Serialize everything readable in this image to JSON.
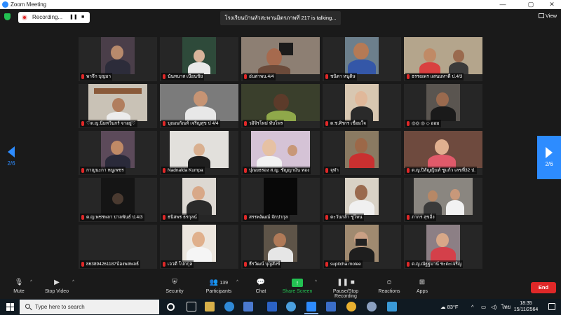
{
  "window": {
    "title": "Zoom Meeting"
  },
  "meeting_bar": {
    "recording_label": "Recording...",
    "talking_text": "โรงเรียนบ้านหัวสะพานมิตรภาพที่ 217 is talking...",
    "view_label": "View"
  },
  "paging": {
    "left_label": "2/6",
    "right_label": "2/6"
  },
  "participants": [
    "พาจึก บุญมา",
    "นันทนาส เนียนชัย",
    "อ่นสาพน.4/4",
    "ชนิดา หนูดิษ",
    "ธรรณพร แสนมหาดี ป.4/3",
    "♡ด.ญ.นิ่มหวิ่นกร์ จาอยู่♡",
    "บุณณกัณท์ เจริญสุข ป 4/4",
    "วอิจิรโหม่ ทับโพร",
    "ด.ช.ศิรกร เชื่อมใจ",
    "◎◎ ◎ ◇ ออม",
    "กาญนะกา หนูเพชร",
    "Nadnafda Kumpa",
    "ปุณยธรอง ส.ญ. ชัญญามัน ทอง",
    "จุฬา",
    "ด.ญ.ปิลัญญินท์ ชูแก้ว เลขที่32 ป.",
    "ด.ญ.พชรพลา ปาลพันธ์ ป.4/3",
    "ธนิสพร ธรกุลน์",
    "สรรพงัฒณ์ จักปากุล",
    "ตะวันกล้า ชูไหน",
    "ภากร สุขอิ่ง",
    "863894261187น้องพลพลธ์",
    "เจวดี โปกกุล",
    "ธีรวัฒน์ บุญสังข์",
    "supitcha molee",
    "ด.ญ.ณัฐฐมาน์ ชะตะเจริญ"
  ],
  "toolbar": {
    "mute_label": "Mute",
    "stop_video_label": "Stop Video",
    "security_label": "Security",
    "participants_label": "Participants",
    "participants_count": "139",
    "chat_label": "Chat",
    "share_label": "Share Screen",
    "record_label": "Pause/Stop Recording",
    "reactions_label": "Reactions",
    "apps_label": "Apps",
    "end_label": "End"
  },
  "taskbar": {
    "search_placeholder": "Type here to search",
    "weather": "83°F",
    "language": "ไทย",
    "time": "18:35",
    "date": "15/11/2564"
  },
  "colors": {
    "zoom_blue": "#2d8cff",
    "share_green": "#23c152",
    "end_red": "#e02828",
    "background": "#1a1a1a"
  },
  "icons": {
    "shield": "shield-icon",
    "recording": "record-dot-icon",
    "mic": "mic-icon",
    "video": "camera-icon",
    "security": "security-shield-icon",
    "participants": "people-icon",
    "chat": "chat-bubble-icon",
    "share": "share-arrow-icon",
    "record": "pause-stop-icon",
    "reactions": "smiley-icon",
    "apps": "apps-icon"
  }
}
